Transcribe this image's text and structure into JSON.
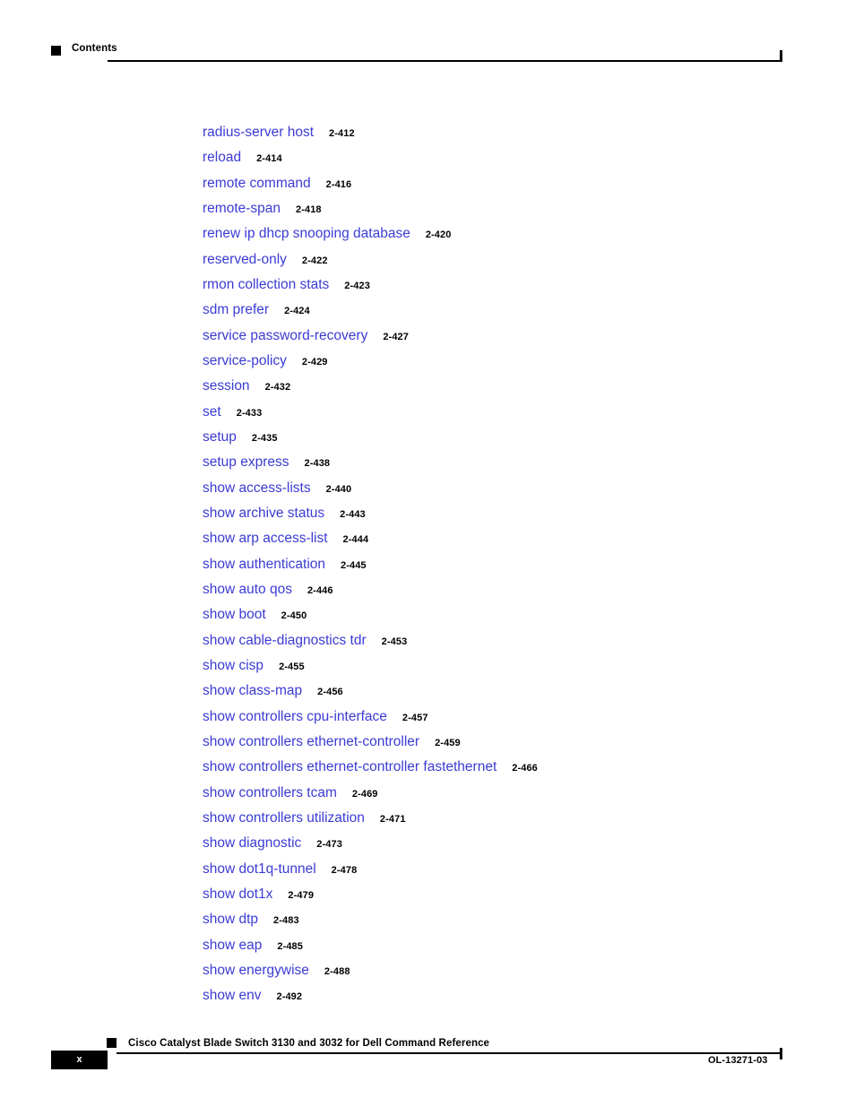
{
  "header": {
    "title": "Contents",
    "marker_icon": "black-square-bullet"
  },
  "toc": {
    "entries": [
      {
        "label": "radius-server host",
        "page": "2-412"
      },
      {
        "label": "reload",
        "page": "2-414"
      },
      {
        "label": "remote command",
        "page": "2-416"
      },
      {
        "label": "remote-span",
        "page": "2-418"
      },
      {
        "label": "renew ip dhcp snooping database",
        "page": "2-420"
      },
      {
        "label": "reserved-only",
        "page": "2-422"
      },
      {
        "label": "rmon collection stats",
        "page": "2-423"
      },
      {
        "label": "sdm prefer",
        "page": "2-424"
      },
      {
        "label": "service password-recovery",
        "page": "2-427"
      },
      {
        "label": "service-policy",
        "page": "2-429"
      },
      {
        "label": "session",
        "page": "2-432"
      },
      {
        "label": "set",
        "page": "2-433"
      },
      {
        "label": "setup",
        "page": "2-435"
      },
      {
        "label": "setup express",
        "page": "2-438"
      },
      {
        "label": "show access-lists",
        "page": "2-440"
      },
      {
        "label": "show archive status",
        "page": "2-443"
      },
      {
        "label": "show arp access-list",
        "page": "2-444"
      },
      {
        "label": "show authentication",
        "page": "2-445"
      },
      {
        "label": "show auto qos",
        "page": "2-446"
      },
      {
        "label": "show boot",
        "page": "2-450"
      },
      {
        "label": "show cable-diagnostics tdr",
        "page": "2-453"
      },
      {
        "label": "show cisp",
        "page": "2-455"
      },
      {
        "label": "show class-map",
        "page": "2-456"
      },
      {
        "label": "show controllers cpu-interface",
        "page": "2-457"
      },
      {
        "label": "show controllers ethernet-controller",
        "page": "2-459"
      },
      {
        "label": "show controllers ethernet-controller fastethernet",
        "page": "2-466"
      },
      {
        "label": "show controllers tcam",
        "page": "2-469"
      },
      {
        "label": "show controllers utilization",
        "page": "2-471"
      },
      {
        "label": "show diagnostic",
        "page": "2-473"
      },
      {
        "label": "show dot1q-tunnel",
        "page": "2-478"
      },
      {
        "label": "show dot1x",
        "page": "2-479"
      },
      {
        "label": "show dtp",
        "page": "2-483"
      },
      {
        "label": "show eap",
        "page": "2-485"
      },
      {
        "label": "show energywise",
        "page": "2-488"
      },
      {
        "label": "show env",
        "page": "2-492"
      }
    ]
  },
  "footer": {
    "document_title": "Cisco Catalyst Blade Switch 3130 and 3032 for Dell Command Reference",
    "page_number": "x",
    "document_number": "OL-13271-03",
    "marker_icon": "black-square-bullet"
  },
  "colors": {
    "link_blue": "#3b3bd4",
    "text_black": "#000000",
    "page_background": "#ffffff"
  }
}
